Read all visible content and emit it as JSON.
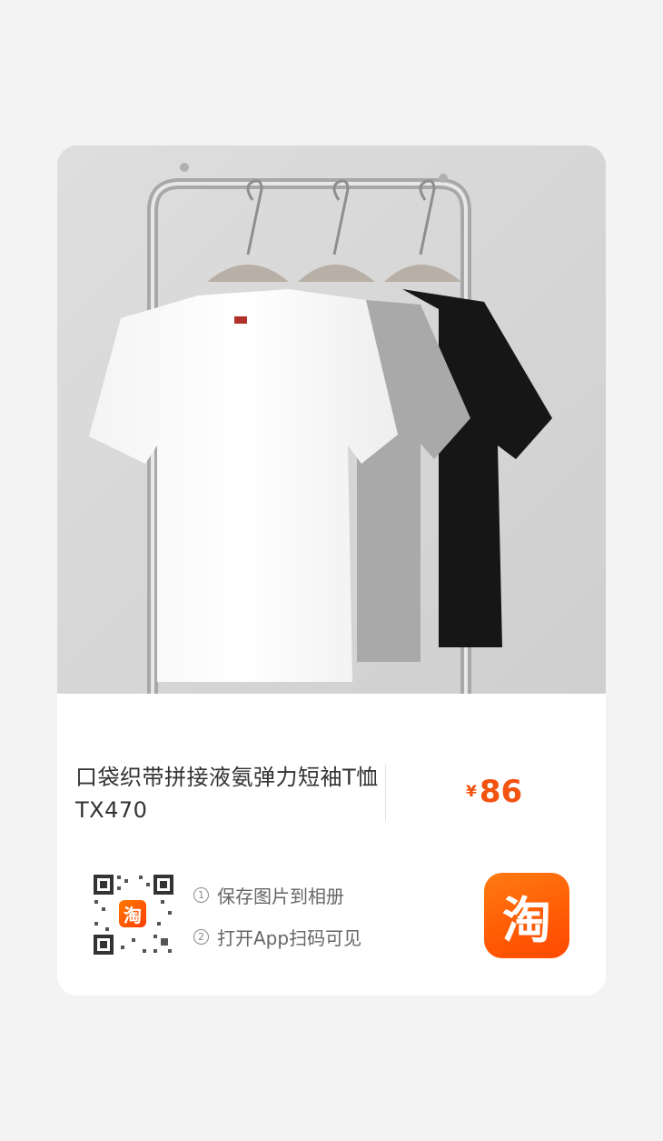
{
  "product": {
    "title": "口袋织带拼接液氨弹力短袖T恤 TX470",
    "price_symbol": "¥",
    "price_amount": "86"
  },
  "photo": {
    "description_icon": "tshirt-rack-photo"
  },
  "qr": {
    "logo_char": "淘"
  },
  "steps": [
    {
      "num": "1",
      "text": "保存图片到相册"
    },
    {
      "num": "2",
      "text": "打开App扫码可见"
    }
  ],
  "app_icon": {
    "char": "淘"
  },
  "colors": {
    "accent": "#f2530f",
    "brand": "#ff5a05"
  }
}
